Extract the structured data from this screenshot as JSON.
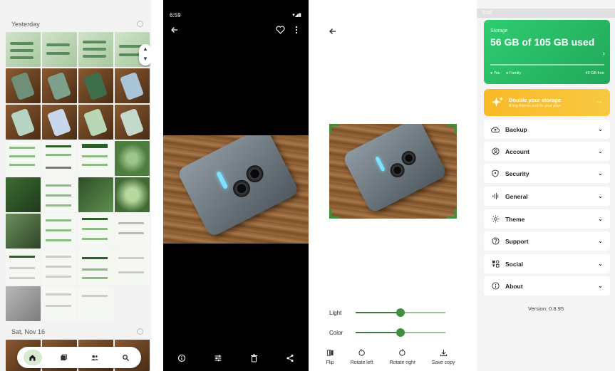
{
  "gallery": {
    "section_yesterday": "Yesterday",
    "section_sat": "Sat, Nov 16",
    "nav": [
      "home-icon",
      "photo-library-icon",
      "people-icon",
      "search-icon"
    ]
  },
  "viewer": {
    "status_time": "6:59",
    "actions": [
      "info-icon",
      "adjust-icon",
      "delete-icon",
      "share-icon"
    ]
  },
  "editor": {
    "light_label": "Light",
    "light_value": 0.5,
    "color_label": "Color",
    "color_value": 0.5,
    "tools": [
      {
        "label": "Flip",
        "icon": "flip-icon"
      },
      {
        "label": "Rotate left",
        "icon": "rotate-left-icon"
      },
      {
        "label": "Rotate right",
        "icon": "rotate-right-icon"
      },
      {
        "label": "Save copy",
        "icon": "download-icon"
      }
    ]
  },
  "settings": {
    "status_time": "6:58",
    "storage_caption": "Storage",
    "storage_used": "56 GB of 105 GB used",
    "legend_you": "You",
    "legend_family": "Family",
    "legend_free": "49 GB free",
    "double_title": "Double your storage",
    "double_sub": "Bring friends and fix your plan",
    "items": [
      "Backup",
      "Account",
      "Security",
      "General",
      "Theme",
      "Support",
      "Social",
      "About"
    ],
    "version": "Version: 0.8.95",
    "colors": {
      "storage": "#2ecc71",
      "promo": "#f9b927",
      "accent": "#3f8f3f"
    }
  }
}
